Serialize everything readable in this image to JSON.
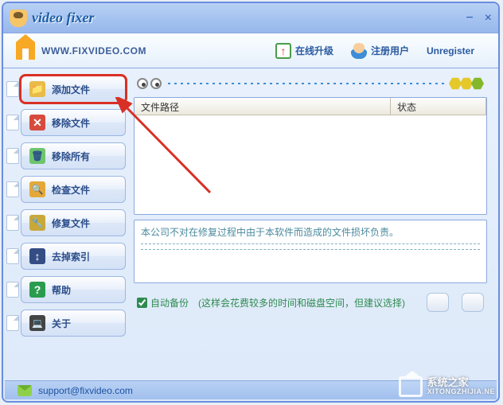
{
  "app": {
    "title": "video fixer",
    "url_label": "WWW.FIXVIDEO.COM"
  },
  "window_controls": {
    "minimize": "−",
    "close": "×"
  },
  "toolbar": {
    "upgrade": "在线升级",
    "register": "注册用户",
    "unregister": "Unregister"
  },
  "sidebar": {
    "items": [
      {
        "id": "add-file",
        "label": "添加文件",
        "icon": "folder",
        "highlighted": true
      },
      {
        "id": "remove-file",
        "label": "移除文件",
        "icon": "remove",
        "highlighted": false
      },
      {
        "id": "remove-all",
        "label": "移除所有",
        "icon": "trash",
        "highlighted": false
      },
      {
        "id": "check-file",
        "label": "检查文件",
        "icon": "check",
        "highlighted": false
      },
      {
        "id": "fix-file",
        "label": "修复文件",
        "icon": "fix",
        "highlighted": false
      },
      {
        "id": "remove-idx",
        "label": "去掉索引",
        "icon": "index",
        "highlighted": false
      },
      {
        "id": "help",
        "label": "帮助",
        "icon": "help",
        "highlighted": false
      },
      {
        "id": "about",
        "label": "关于",
        "icon": "about",
        "highlighted": false
      }
    ]
  },
  "filelist": {
    "col_path": "文件路径",
    "col_status": "状态"
  },
  "message": {
    "text": "本公司不对在修复过程中由于本软件而造成的文件损坏负责。"
  },
  "bottom": {
    "auto_backup_label": "自动备份",
    "auto_backup_checked": true,
    "hint": "(这样会花费较多的时间和磁盘空间，但建议选择)"
  },
  "statusbar": {
    "email": "support@fixvideo.com"
  },
  "watermark": {
    "name": "系统之家",
    "sub": "XITONGZHIJIA.NE"
  }
}
